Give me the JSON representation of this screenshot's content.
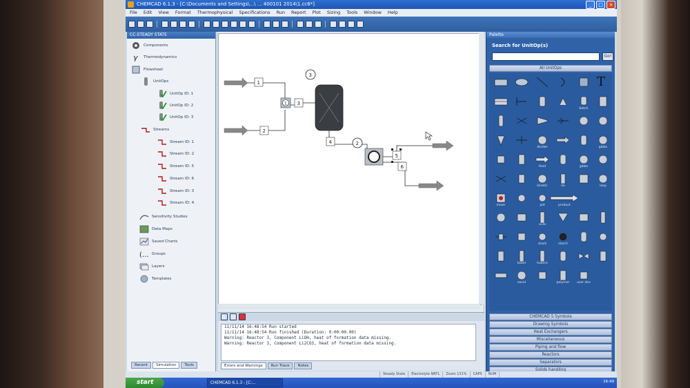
{
  "window": {
    "title": "CHEMCAD 6.1.3 - [C:\\Documents and Settings\\...\\ ... 400101 2014\\1.cc6*]"
  },
  "menu": [
    "File",
    "Edit",
    "View",
    "Format",
    "Thermophysical",
    "Specifications",
    "Run",
    "Report",
    "Plot",
    "Sizing",
    "Tools",
    "Window",
    "Help"
  ],
  "explorer": {
    "header": "CC-STEADY STATE",
    "items": [
      {
        "label": "Components",
        "icon": "components-icon"
      },
      {
        "label": "Thermodynamics",
        "icon": "thermodynamics-icon"
      },
      {
        "label": "Flowsheet",
        "icon": "flowsheet-icon"
      },
      {
        "label": "UnitOps",
        "icon": "unitops-icon"
      },
      {
        "label": "UnitOp ID: 1",
        "icon": "unitop-check-icon"
      },
      {
        "label": "UnitOp ID: 2",
        "icon": "unitop-check-icon"
      },
      {
        "label": "UnitOp ID: 3",
        "icon": "unitop-check-icon"
      },
      {
        "label": "Streams",
        "icon": "streams-icon"
      },
      {
        "label": "Stream ID: 1",
        "icon": "stream-icon"
      },
      {
        "label": "Stream ID: 2",
        "icon": "stream-icon"
      },
      {
        "label": "Stream ID: 5",
        "icon": "stream-icon"
      },
      {
        "label": "Stream ID: 6",
        "icon": "stream-icon"
      },
      {
        "label": "Stream ID: 3",
        "icon": "stream-icon"
      },
      {
        "label": "Stream ID: 4",
        "icon": "stream-icon"
      },
      {
        "label": "Sensitivity Studies",
        "icon": "sensitivity-icon"
      },
      {
        "label": "Data Maps",
        "icon": "datamaps-icon"
      },
      {
        "label": "Saved Charts",
        "icon": "charts-icon"
      },
      {
        "label": "Groups",
        "icon": "groups-icon"
      },
      {
        "label": "Layers",
        "icon": "layers-icon"
      },
      {
        "label": "Templates",
        "icon": "templates-icon"
      }
    ],
    "tabs": [
      "Recent",
      "Simulation",
      "Tools"
    ]
  },
  "flowsheet": {
    "streams": [
      "1",
      "2",
      "3",
      "4",
      "5",
      "6"
    ],
    "unitops": [
      "1",
      "2",
      "3"
    ]
  },
  "messages": {
    "lines": [
      "11/11/14 16:48:54        Run started",
      "11/11/14 16:48:54        Run finished (Duration: 0:00:00.00)",
      "Warning: Reactor 3, Component LiOH, heat of formation data missing.",
      "Warning: Reactor 3, Component Li2CO3, heat of formation data missing."
    ],
    "tabs": [
      "Errors and Warnings",
      "Run Trace",
      "Notes"
    ]
  },
  "palette": {
    "header": "Palette",
    "search_label": "Search for UnitOp(s)",
    "search_placeholder": "",
    "go_label": "Go!",
    "tab_all": "All UnitOps",
    "labels": [
      "batch",
      "divider",
      "feed",
      "gibbs",
      "kinetic",
      "lle",
      "loop",
      "mixer",
      "pid",
      "product",
      "scds",
      "stack",
      "stoich",
      "tower",
      "towerx",
      "excel",
      "polymer",
      "user dev"
    ],
    "sections": [
      "CHEMCAD 5 Symbols",
      "Drawing Symbols",
      "Heat Exchangers",
      "Miscellaneous",
      "Piping and flow",
      "Reactors",
      "Separators",
      "Solids handling"
    ]
  },
  "status": {
    "cells": [
      "Steady State",
      "Electrolyte NRTL",
      "Zoom 131%",
      "CAPS",
      "NUM"
    ]
  },
  "taskbar": {
    "start": "start",
    "app": "CHEMCAD 6.1.3 - [C:...",
    "clock": "16:49"
  },
  "colors": {
    "titlebar": "#1f55b5",
    "palette_bg": "#2f62a6",
    "stream_arrow": "#888888"
  }
}
